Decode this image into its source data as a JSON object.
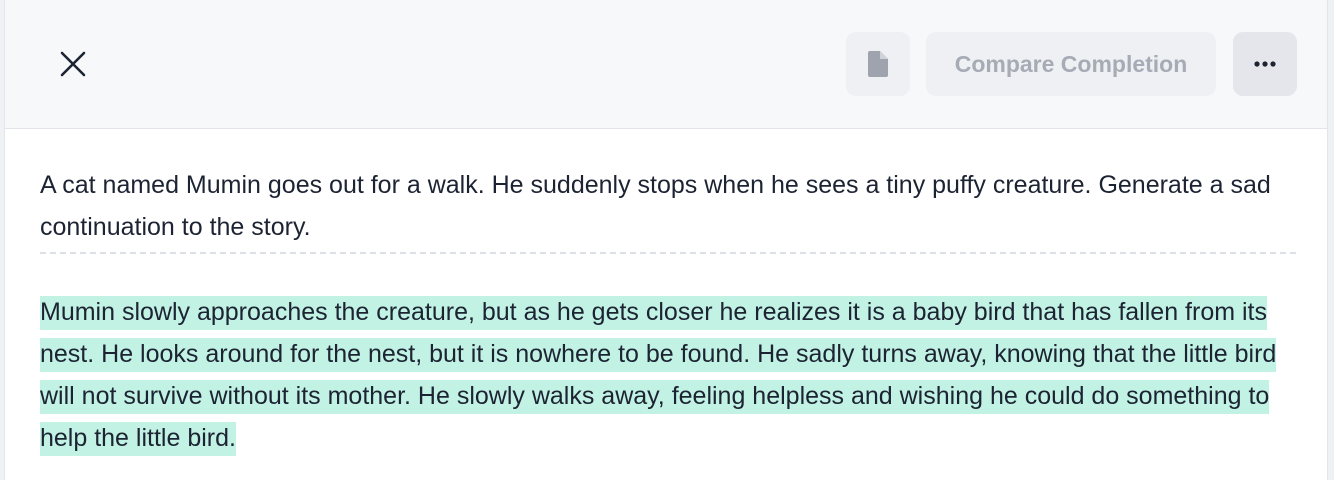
{
  "toolbar": {
    "close_icon": "close-icon",
    "document_icon": "document-icon",
    "compare_label": "Compare Completion",
    "more_icon": "more-horizontal-icon"
  },
  "prompt": {
    "text": "A cat named Mumin goes out for a walk. He suddenly stops when he sees a tiny puffy creature. Generate a sad continuation to the story."
  },
  "completion": {
    "text": "Mumin slowly approaches the creature, but as he gets closer he realizes it is a baby bird that has fallen from its nest. He looks around for the nest, but it is nowhere to be found. He sadly turns away, knowing that the little bird will not survive without its mother. He slowly walks away, feeling helpless and wishing he could do something to help the little bird.",
    "highlight_color": "#c2f2e3"
  }
}
